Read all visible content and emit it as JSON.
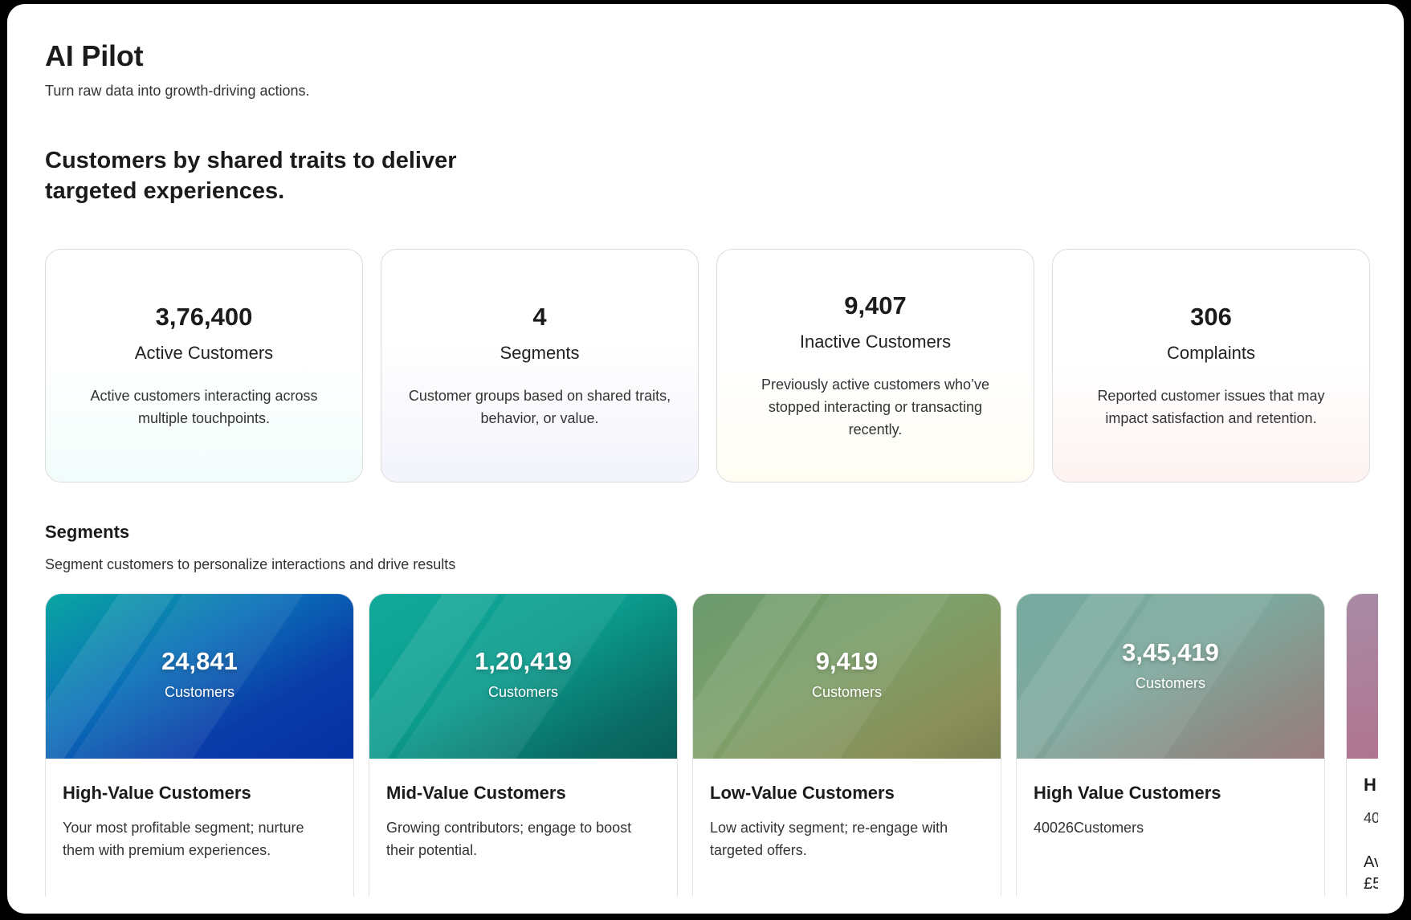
{
  "header": {
    "title": "AI Pilot",
    "subtitle": "Turn raw data into growth-driving actions."
  },
  "section_heading": "Customers by shared traits to deliver targeted experiences.",
  "stats": [
    {
      "value": "3,76,400",
      "label": "Active Customers",
      "description": "Active customers interacting across multiple touchpoints."
    },
    {
      "value": "4",
      "label": "Segments",
      "description": "Customer groups based on shared traits, behavior, or value."
    },
    {
      "value": "9,407",
      "label": "Inactive Customers",
      "description": "Previously active customers who’ve stopped interacting or transacting recently."
    },
    {
      "value": "306",
      "label": "Complaints",
      "description": "Reported customer issues that may impact satisfaction and retention."
    }
  ],
  "segments_section": {
    "title": "Segments",
    "subtitle": "Segment customers to personalize interactions and drive results"
  },
  "segments": [
    {
      "count": "24,841",
      "unit": "Customers",
      "name": "High-Value Customers",
      "description": "Your most profitable segment; nurture them with premium experiences.",
      "color": "#0a3ca8"
    },
    {
      "count": "1,20,419",
      "unit": "Customers",
      "name": "Mid-Value Customers",
      "description": "Growing contributors; engage to boost their potential.",
      "color": "#0b9c8e"
    },
    {
      "count": "9,419",
      "unit": "Customers",
      "name": "Low-Value Customers",
      "description": "Low activity segment; re-engage with targeted offers.",
      "color": "#7da06a"
    },
    {
      "count": "3,45,419",
      "unit": "Customers",
      "name": "High Value Customers",
      "description": "40026Customers",
      "color": "#7ea89d"
    }
  ],
  "partial_segment": {
    "name": "H",
    "line1": "40",
    "line2": "Av",
    "line3": "£5",
    "color": "#b3708a"
  }
}
